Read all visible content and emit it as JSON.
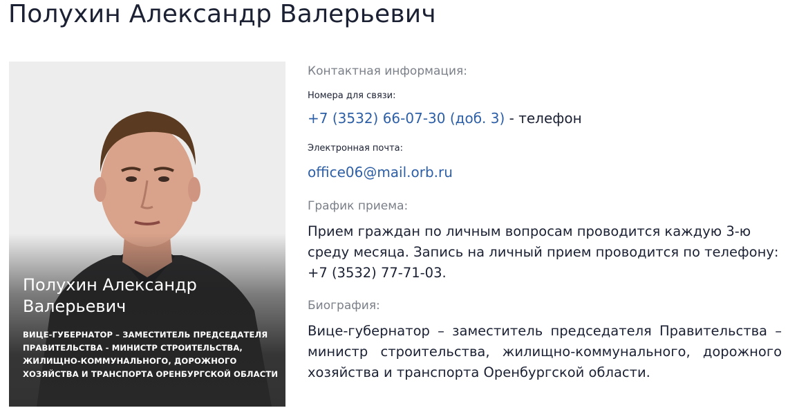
{
  "page": {
    "title": "Полухин Александр Валерьевич"
  },
  "card": {
    "name": "Полухин Александр Валерьевич",
    "position": "Вице-губернатор – заместитель председателя Правительства - министр строительства, жилищно-коммунального, дорожного хозяйства и транспорта Оренбургской области"
  },
  "contacts": {
    "heading": "Контактная информация:",
    "phone_label": "Номера для связи:",
    "phone": "+7 (3532) 66-07-30 (доб. 3)",
    "phone_suffix": " - телефон",
    "email_label": "Электронная почта:",
    "email": "office06@mail.orb.ru"
  },
  "schedule": {
    "heading": "График приема:",
    "text": "Прием граждан по личным вопросам проводится каждую 3-ю среду месяца. Запись на личный прием проводится по телефону: +7 (3532) 77-71-03."
  },
  "biography": {
    "heading": "Биография:",
    "text": "Вице-губернатор – заместитель председателя Правительства – министр строительства, жилищно-коммунального, дорожного хозяйства и транспорта Оренбургской области."
  },
  "colors": {
    "title": "#1b2133",
    "link": "#2d5fa6",
    "muted": "#7a7f88",
    "card_overlay": "#2a2a2a"
  }
}
